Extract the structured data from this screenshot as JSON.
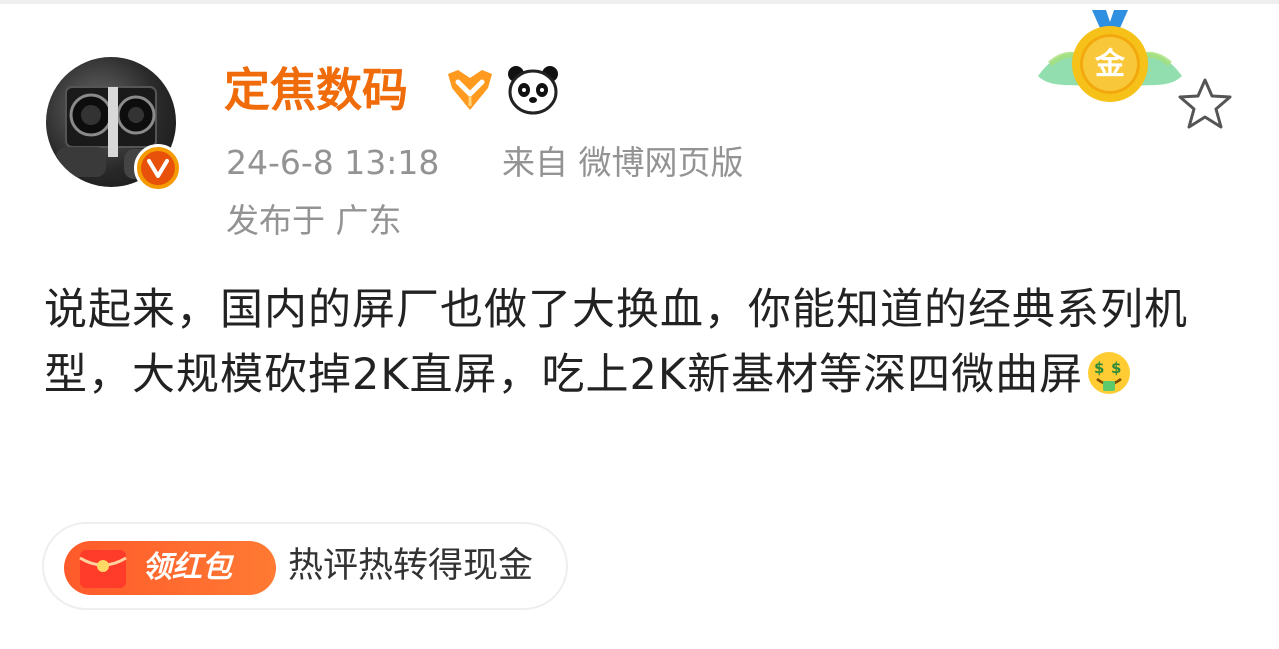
{
  "post": {
    "author": {
      "name": "定焦数码",
      "verified_icon": "verified-v-icon",
      "badges": [
        "orange-vip-badge-icon",
        "panda-badge-icon"
      ]
    },
    "meta": {
      "time": "24-6-8 13:18",
      "source": "来自 微博网页版",
      "location": "发布于 广东"
    },
    "medal": {
      "label": "金"
    },
    "content": {
      "text": "说起来，国内的屏厂也做了大换血，你能知道的经典系列机型，大规模砍掉2K直屏，吃上2K新基材等深四微曲屏",
      "trailing_emoji": "money-mouth-emoji-icon"
    },
    "promo": {
      "badge_label": "领红包",
      "text": "热评热转得现金"
    }
  },
  "colors": {
    "author_name": "#f06b0a",
    "meta_text": "#939393",
    "body_text": "#222222",
    "promo_gradient_start": "#ff5a2b",
    "promo_gradient_end": "#ff7a33",
    "verified_badge": "#e8510a"
  }
}
